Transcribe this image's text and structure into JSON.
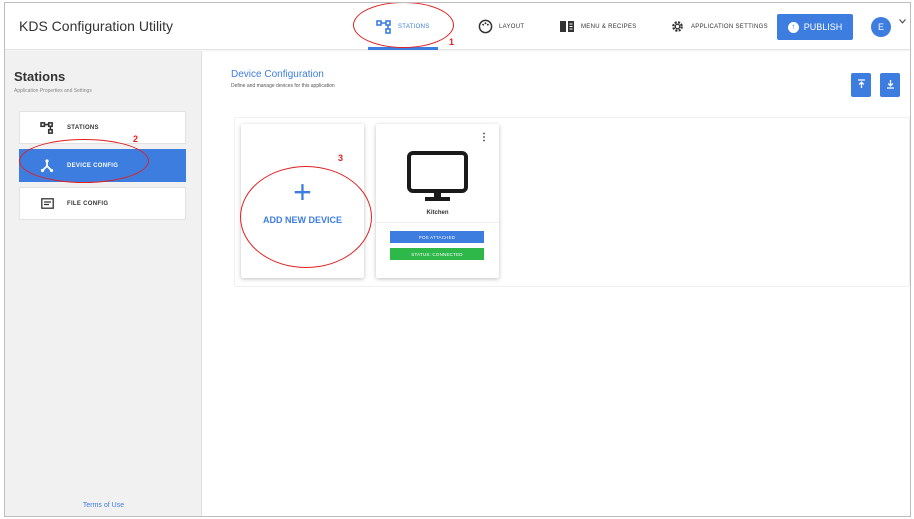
{
  "app": {
    "title": "KDS Configuration Utility"
  },
  "nav": {
    "tabs": [
      {
        "label": "STATIONS",
        "icon": "stations-icon",
        "active": true
      },
      {
        "label": "LAYOUT",
        "icon": "palette-icon",
        "active": false
      },
      {
        "label": "MENU & RECIPES",
        "icon": "menu-book-icon",
        "active": false
      },
      {
        "label": "APPLICATION SETTINGS",
        "icon": "gear-icon",
        "active": false
      }
    ],
    "publish_label": "PUBLISH",
    "avatar_initial": "E"
  },
  "sidebar": {
    "title": "Stations",
    "subtitle": "Application Properties and Settings",
    "items": [
      {
        "label": "STATIONS",
        "icon": "stations-icon",
        "active": false
      },
      {
        "label": "DEVICE CONFIG",
        "icon": "device-hub-icon",
        "active": true
      },
      {
        "label": "FILE CONFIG",
        "icon": "file-config-icon",
        "active": false
      }
    ],
    "terms_label": "Terms of Use"
  },
  "main": {
    "title": "Device Configuration",
    "subtitle": "Define and manage devices for this application",
    "add_card": {
      "plus": "+",
      "label": "ADD NEW DEVICE"
    },
    "devices": [
      {
        "name": "Kitchen",
        "pos_status": "POS ATTACHED",
        "conn_status": "STATUS: CONNECTED"
      }
    ]
  },
  "annotations": [
    "1",
    "2",
    "3"
  ],
  "colors": {
    "accent": "#3d7de0",
    "connected": "#2fb84a",
    "annotation": "#e02020",
    "sidebar_bg": "#f1f1f1"
  }
}
